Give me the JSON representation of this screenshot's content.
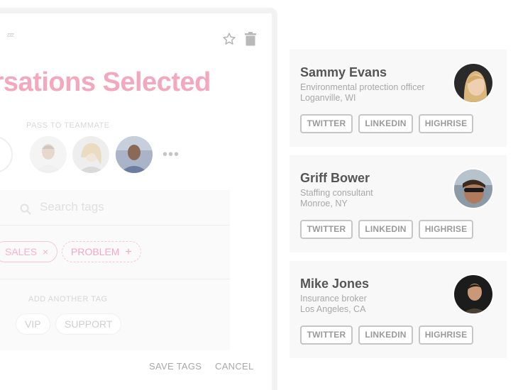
{
  "modal": {
    "title": "ersations Selected",
    "sleep_glyph": "ᶻᶻᶻ",
    "pass_label": "PASS TO TEAMMATE",
    "more": "•••",
    "search_placeholder": "Search tags",
    "tags": [
      {
        "label": "SALES",
        "action": "×"
      },
      {
        "label": "PROBLEM",
        "action": "+"
      }
    ],
    "add_label": "ADD ANOTHER TAG",
    "suggested": [
      "VIP",
      "SUPPORT"
    ],
    "save_label": "SAVE TAGS",
    "cancel_label": "CANCEL",
    "accent": "#f4a8be"
  },
  "contacts": [
    {
      "name": "Sammy Evans",
      "role": "Environmental protection officer",
      "location": "Loganville, WI"
    },
    {
      "name": "Griff Bower",
      "role": "Staffing consultant",
      "location": "Monroe, NY"
    },
    {
      "name": "Mike Jones",
      "role": "Insurance broker",
      "location": "Los Angeles, CA"
    }
  ],
  "buttons": {
    "twitter": "TWITTER",
    "linkedin": "LINKEDIN",
    "highrise": "HIGHRISE"
  }
}
